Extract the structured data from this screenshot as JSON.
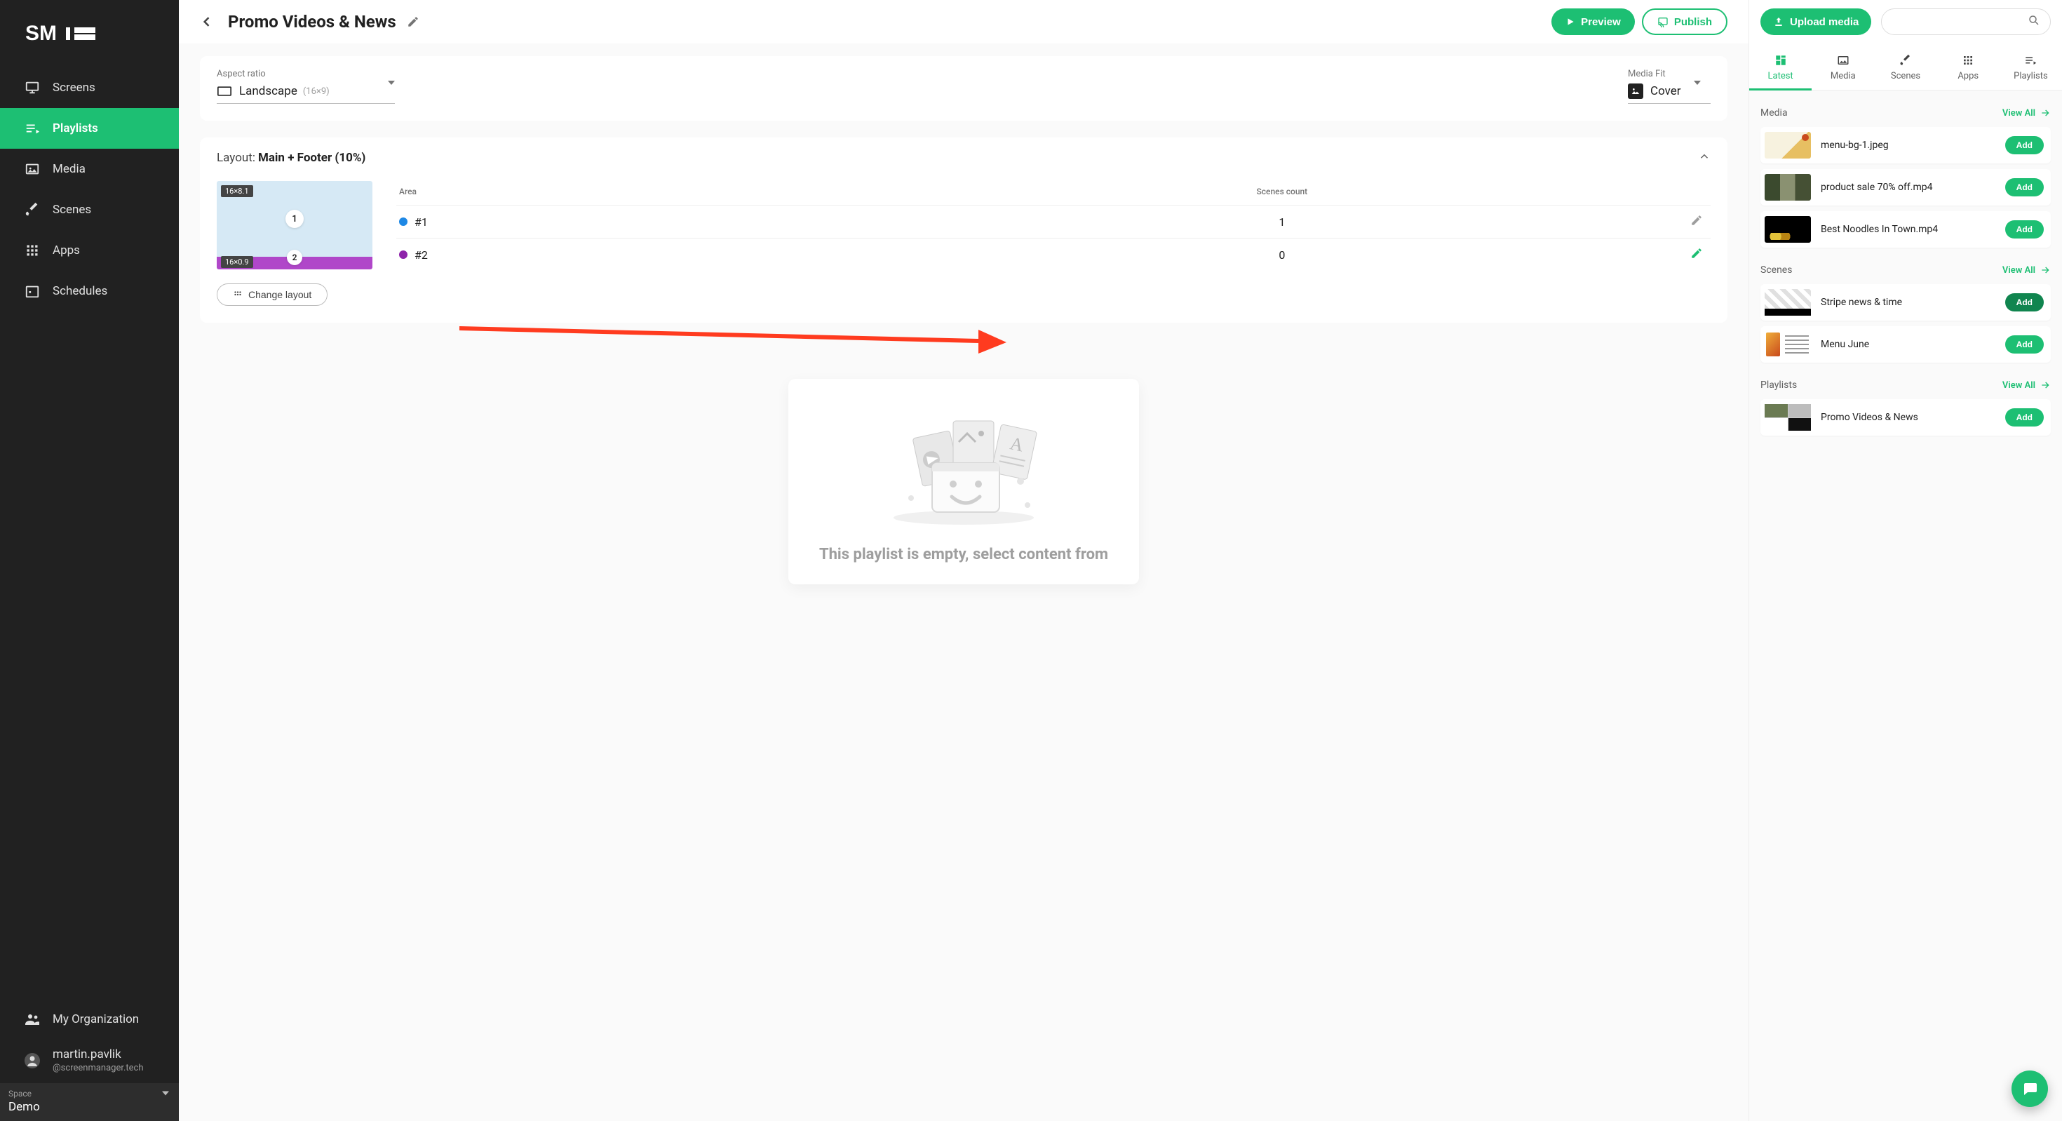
{
  "sidebar": {
    "logo": "SM",
    "nav": [
      {
        "label": "Screens",
        "icon": "monitor"
      },
      {
        "label": "Playlists",
        "icon": "playlist",
        "active": true
      },
      {
        "label": "Media",
        "icon": "image"
      },
      {
        "label": "Scenes",
        "icon": "brush"
      },
      {
        "label": "Apps",
        "icon": "grid"
      },
      {
        "label": "Schedules",
        "icon": "calendar"
      }
    ],
    "org_label": "My Organization",
    "user_name": "martin.pavlik",
    "user_email": "@screenmanager.tech",
    "space_label": "Space",
    "space_value": "Demo"
  },
  "header": {
    "title": "Promo Videos & News",
    "preview_label": "Preview",
    "publish_label": "Publish"
  },
  "settings": {
    "aspect_label": "Aspect ratio",
    "aspect_value": "Landscape",
    "aspect_sub": "(16×9)",
    "fit_label": "Media Fit",
    "fit_value": "Cover"
  },
  "layout": {
    "prefix": "Layout:",
    "value": "Main + Footer (10%)",
    "change_label": "Change layout",
    "preview": {
      "area1_badge": "16×8.1",
      "area1_num": "1",
      "area2_badge": "16×0.9",
      "area2_num": "2"
    },
    "table": {
      "col_area": "Area",
      "col_count": "Scenes count",
      "rows": [
        {
          "name": "#1",
          "count": "1",
          "dot": "blue",
          "edit": "gray"
        },
        {
          "name": "#2",
          "count": "0",
          "dot": "purple",
          "edit": "green"
        }
      ]
    }
  },
  "empty": {
    "line": "This playlist is empty, select content from"
  },
  "right": {
    "upload_label": "Upload media",
    "search_placeholder": "",
    "tabs": [
      {
        "label": "Latest",
        "icon": "dashboard",
        "active": true
      },
      {
        "label": "Media",
        "icon": "image"
      },
      {
        "label": "Scenes",
        "icon": "brush"
      },
      {
        "label": "Apps",
        "icon": "grid"
      },
      {
        "label": "Playlists",
        "icon": "playlist"
      }
    ],
    "view_all": "View All",
    "add": "Add",
    "sections": [
      {
        "title": "Media",
        "items": [
          {
            "name": "menu-bg-1.jpeg",
            "thumb": "menu"
          },
          {
            "name": "product sale 70% off.mp4",
            "thumb": "sale"
          },
          {
            "name": "Best Noodles In Town.mp4",
            "thumb": "noodles"
          }
        ]
      },
      {
        "title": "Scenes",
        "items": [
          {
            "name": "Stripe news & time",
            "thumb": "stripe",
            "highlight": true
          },
          {
            "name": "Menu June",
            "thumb": "menu2"
          }
        ]
      },
      {
        "title": "Playlists",
        "items": [
          {
            "name": "Promo Videos & News",
            "thumb": "promo"
          }
        ]
      }
    ]
  }
}
